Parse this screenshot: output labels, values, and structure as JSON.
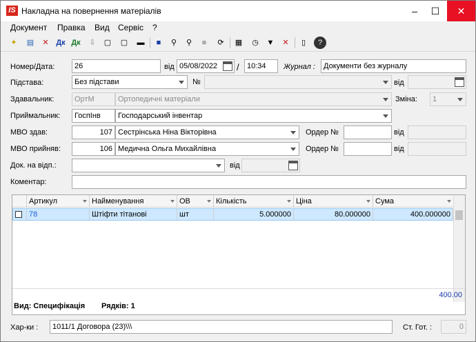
{
  "window": {
    "title": "Накладна на повернення матеріалів",
    "logo": "IS"
  },
  "menu": [
    "Документ",
    "Правка",
    "Вид",
    "Сервіс",
    "?"
  ],
  "toolbar_icons": [
    "new-doc-icon",
    "open-doc-icon",
    "delete-doc-icon",
    "debit-icon",
    "credit-icon",
    "import-icon",
    "export-icon",
    "copy-icon",
    "print-icon",
    "save-icon",
    "find-icon",
    "find-next-icon",
    "edit-icon",
    "refresh-icon",
    "list-icon",
    "grid-icon",
    "history-icon",
    "filter-icon",
    "clear-filter-icon",
    "properties-icon",
    "help-icon"
  ],
  "form": {
    "number_label": "Номер/Дата:",
    "number": "26",
    "from_label": "від",
    "date": "05/08/2022",
    "time": "10:34",
    "time_sep": "/",
    "journal_label": "Журнал :",
    "journal": "Документи без журналу",
    "basis_label": "Підстава:",
    "basis": "Без підстави",
    "basis_no_label": "№",
    "basis_from_label": "від",
    "sender_label": "Здавальник:",
    "sender_code": "ОртМ",
    "sender_name": "Ортопедичні матеріали",
    "shift_label": "Зміна:",
    "shift": "1",
    "receiver_label": "Приймальник:",
    "receiver_code": "ГоспІнв",
    "receiver_name": "Господарський інвентар",
    "mvo_from_label": "МВО здав:",
    "mvo_from_code": "107",
    "mvo_from_name": "Сестрінська Ніна Вікторівна",
    "order1_label": "Ордер №",
    "order1_from_label": "від",
    "mvo_to_label": "МВО прийняв:",
    "mvo_to_code": "106",
    "mvo_to_name": "Медична Ольга Михайлівна",
    "order2_label": "Ордер №",
    "order2_from_label": "від",
    "doc_label": "Док. на відп.:",
    "doc_from_label": "від",
    "comment_label": "Коментар:"
  },
  "table": {
    "columns": [
      "Артикул",
      "Найменування",
      "ОВ",
      "Кількість",
      "Ціна",
      "Сума"
    ],
    "rows": [
      {
        "article": "78",
        "name": "Штіфти тітанові",
        "unit": "шт",
        "qty": "5.000000",
        "price": "80.000000",
        "sum": "400.000000"
      }
    ],
    "total": "400.00",
    "status_view": "Вид: Специфікація",
    "status_rows": "Рядків: 1"
  },
  "bottom": {
    "chars_label": "Хар-ки :",
    "chars": "1011/1 Договора (23)\\\\\\",
    "ready_label": "Ст. Гот. :",
    "ready": "0"
  }
}
